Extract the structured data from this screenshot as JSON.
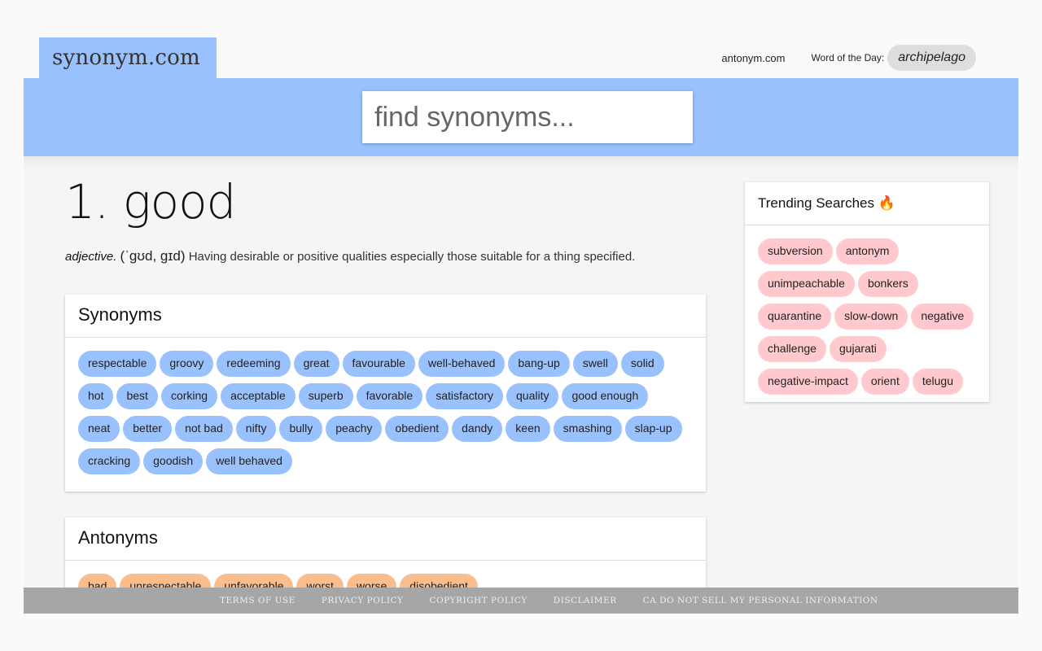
{
  "header": {
    "logo": "synonym.com",
    "antonym_link": "antonym.com",
    "word_of_day_label": "Word of the Day:",
    "word_of_day": "archipelago"
  },
  "search": {
    "placeholder": "find synonyms..."
  },
  "entry": {
    "title": "1. good",
    "part_of_speech": "adjective.",
    "pronunciation": "(ˈɡʊd, ɡɪd)",
    "definition": "Having desirable or positive qualities especially those suitable for a thing specified."
  },
  "synonyms": {
    "heading": "Synonyms",
    "items": [
      "respectable",
      "groovy",
      "redeeming",
      "great",
      "favourable",
      "well-behaved",
      "bang-up",
      "swell",
      "solid",
      "hot",
      "best",
      "corking",
      "acceptable",
      "superb",
      "favorable",
      "satisfactory",
      "quality",
      "good enough",
      "neat",
      "better",
      "not bad",
      "nifty",
      "bully",
      "peachy",
      "obedient",
      "dandy",
      "keen",
      "smashing",
      "slap-up",
      "cracking",
      "goodish",
      "well behaved"
    ]
  },
  "antonyms": {
    "heading": "Antonyms",
    "items": [
      "bad",
      "unrespectable",
      "unfavorable",
      "worst",
      "worse",
      "disobedient"
    ]
  },
  "trending": {
    "heading": "Trending Searches 🔥",
    "items": [
      "subversion",
      "antonym",
      "unimpeachable",
      "bonkers",
      "quarantine",
      "slow-down",
      "negative",
      "challenge",
      "gujarati",
      "negative-impact",
      "orient",
      "telugu"
    ]
  },
  "footer": {
    "links": [
      "TERMS OF USE",
      "PRIVACY POLICY",
      "COPYRIGHT POLICY",
      "DISCLAIMER",
      "CA DO NOT SELL MY PERSONAL INFORMATION"
    ]
  },
  "colors": {
    "accent_blue": "#98c1fd",
    "antonym_orange": "#fbbd8c",
    "trending_pink": "#ffc9cd",
    "footer_gray": "#a6a6a6"
  }
}
